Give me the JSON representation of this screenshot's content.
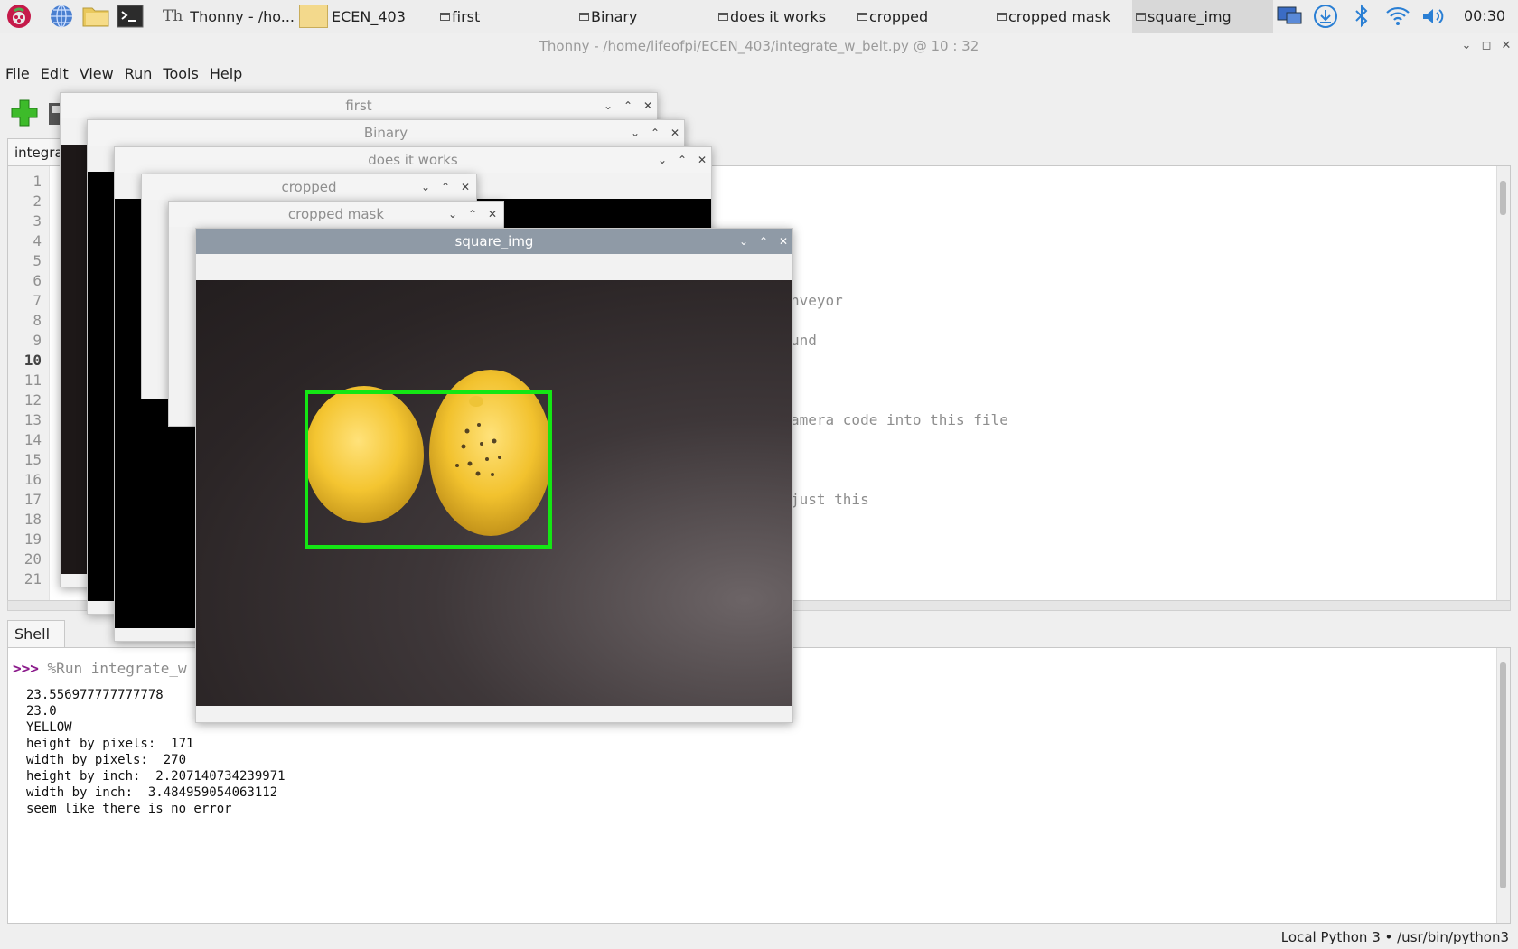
{
  "taskbar": {
    "items": [
      {
        "label": "Thonny  -  /ho..."
      },
      {
        "label": "ECEN_403"
      },
      {
        "label": "first"
      },
      {
        "label": "Binary"
      },
      {
        "label": "does it works"
      },
      {
        "label": "cropped"
      },
      {
        "label": "cropped mask"
      },
      {
        "label": "square_img"
      }
    ],
    "clock": "00:30"
  },
  "window": {
    "title": "Thonny  -  /home/lifeofpi/ECEN_403/integrate_w_belt.py  @  10 : 32"
  },
  "menu": [
    "File",
    "Edit",
    "View",
    "Run",
    "Tools",
    "Help"
  ],
  "editor": {
    "tab_label": "integrate",
    "line_numbers": [
      "1",
      "2",
      "3",
      "4",
      "5",
      "6",
      "7",
      "8",
      "9",
      "10",
      "11",
      "12",
      "13",
      "14",
      "15",
      "16",
      "17",
      "18",
      "19",
      "20",
      "21"
    ],
    "current_line": "10",
    "visible_fragments": [
      "nveyor",
      "und",
      "amera code into this file",
      "just this"
    ]
  },
  "shell": {
    "tab_label": "Shell",
    "prompt": ">>>",
    "command": "%Run integrate_w",
    "output": [
      "23.556977777777778",
      "23.0",
      "YELLOW",
      "height by pixels:  171",
      "width by pixels:  270",
      "height by inch:  2.207140734239971",
      "width by inch:  3.484959054063112",
      "seem like there is no error"
    ]
  },
  "statusbar": "Local Python 3  •  /usr/bin/python3",
  "cv_windows": [
    "first",
    "Binary",
    "does it works",
    "cropped",
    "cropped mask",
    "square_img"
  ],
  "colors": {
    "detect_box": "#14e614",
    "active_title": "#8f9aa6"
  }
}
